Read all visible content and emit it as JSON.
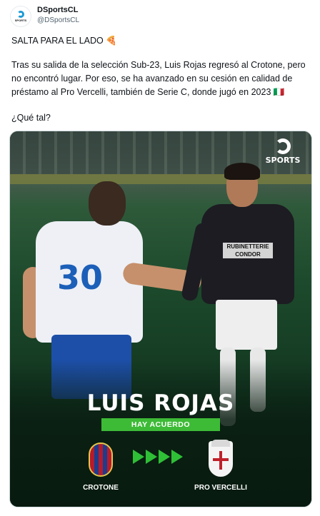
{
  "tweet": {
    "author_name": "DSportsCL",
    "author_handle": "@DSportsCL",
    "avatar_text": "SPORTS",
    "line1": "SALTA PARA EL LADO 🍕",
    "body": "Tras su salida de la selección Sub-23, Luis Rojas regresó al Crotone, pero no encontró lugar. Por eso, se ha avanzado en su cesión en calidad de préstamo al Pro Vercelli, también de Serie C, donde jugó en 2023 🇮🇹",
    "question": "¿Qué tal?"
  },
  "media": {
    "logo_text": "SPORTS",
    "headline": "LUIS ROJAS",
    "badge": "HAY ACUERDO",
    "club_from": "CROTONE",
    "club_to": "PRO VERCELLI",
    "shirt_number": "30",
    "sponsor": "RUBINETTERIE CONDOR",
    "colors": {
      "badge": "#3dbb37",
      "arrows": "#2fbf36",
      "field_dark": "#0a2414"
    }
  }
}
